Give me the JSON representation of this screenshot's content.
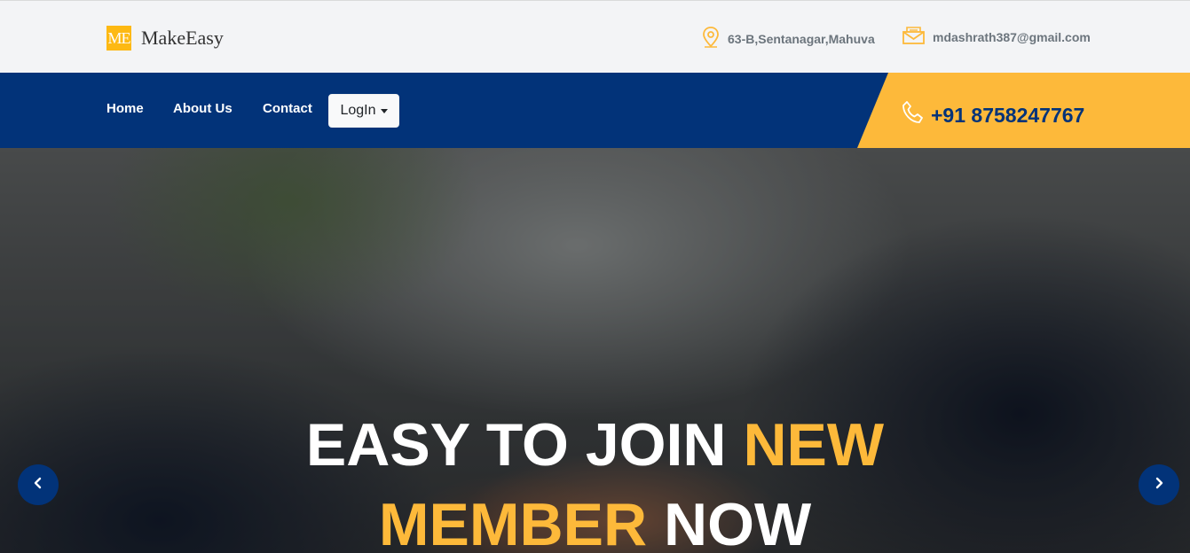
{
  "brand": {
    "logo_mark": "ME",
    "name": "MakeEasy"
  },
  "contact_info": {
    "address": "63-B,Sentanagar,Mahuva",
    "email": "mdashrath387@gmail.com",
    "phone": "+91 8758247767"
  },
  "nav": {
    "home": "Home",
    "about": "About Us",
    "contact": "Contact",
    "login": "LogIn"
  },
  "hero": {
    "line1_white": "EASY TO JOIN ",
    "line1_highlight": "NEW",
    "line2_highlight": "MEMBER",
    "line2_white": " NOW"
  },
  "colors": {
    "navy": "#023379",
    "accent": "#fdb93a",
    "topbar_bg": "#f3f4f6"
  },
  "icons": {
    "address": "map-pin-icon",
    "email": "envelope-icon",
    "phone": "phone-icon",
    "prev": "chevron-left-icon",
    "next": "chevron-right-icon"
  }
}
